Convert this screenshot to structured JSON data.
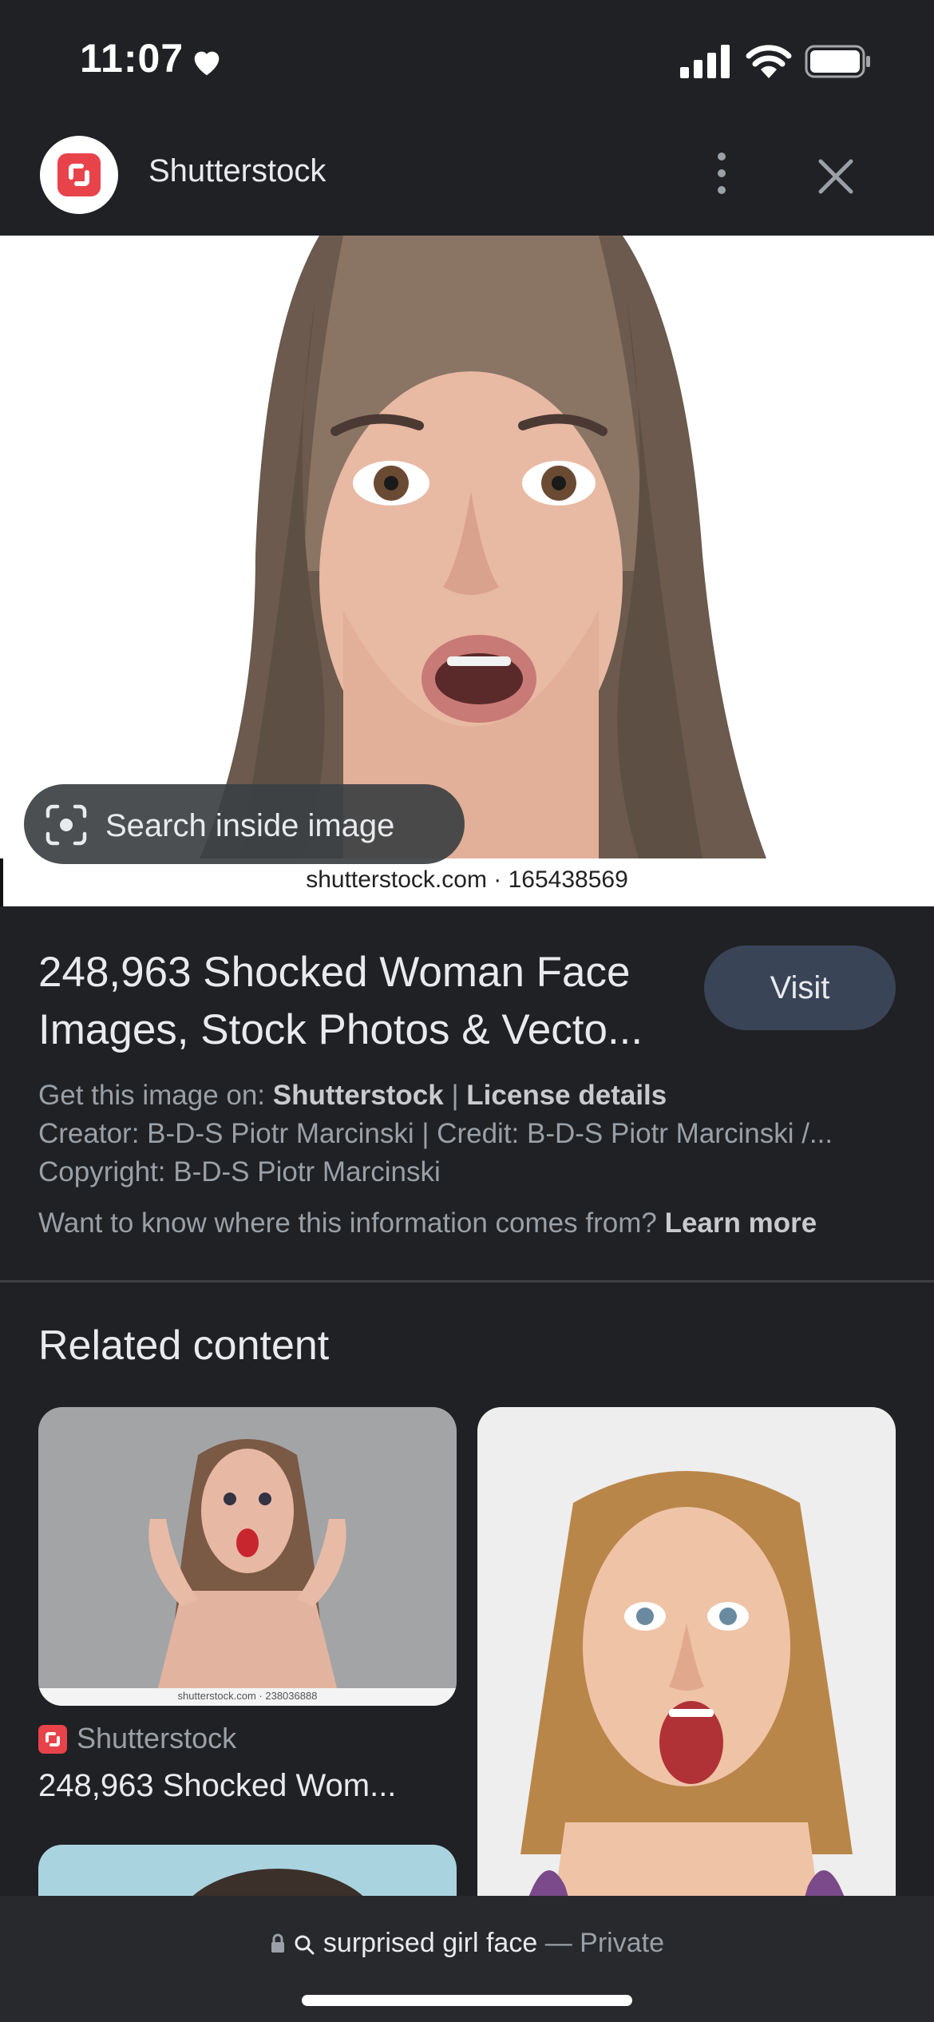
{
  "status": {
    "time": "11:07"
  },
  "header": {
    "site_name": "Shutterstock"
  },
  "hero": {
    "caption": "shutterstock.com · 165438569",
    "search_inside_label": "Search inside image"
  },
  "result": {
    "title": "248,963 Shocked Woman Face Images, Stock Photos & Vecto...",
    "visit_label": "Visit",
    "get_image_prefix": "Get this image on:",
    "get_image_source": "Shutterstock",
    "separator": "|",
    "license_link": "License details",
    "creator_line": "Creator: B-D-S Piotr Marcinski | Credit: B-D-S Piotr Marcinski /...",
    "copyright_line": "Copyright: B-D-S Piotr Marcinski",
    "learn_prefix": "Want to know where this information comes from?",
    "learn_more": "Learn more"
  },
  "related": {
    "heading": "Related content",
    "items": [
      {
        "caption_small": "shutterstock.com · 238036888",
        "source": "Shutterstock",
        "title": "248,963 Shocked Wom..."
      }
    ]
  },
  "bottom": {
    "query": "surprised girl face",
    "dash": "—",
    "mode": "Private"
  },
  "colors": {
    "background": "#202124",
    "visit_button": "#394457",
    "brand_red": "#e8434a"
  },
  "icons": [
    "heart-icon",
    "cellular-signal-icon",
    "wifi-icon",
    "battery-icon",
    "shutterstock-logo-icon",
    "more-vert-icon",
    "close-icon",
    "lens-icon",
    "lock-icon",
    "search-icon"
  ]
}
